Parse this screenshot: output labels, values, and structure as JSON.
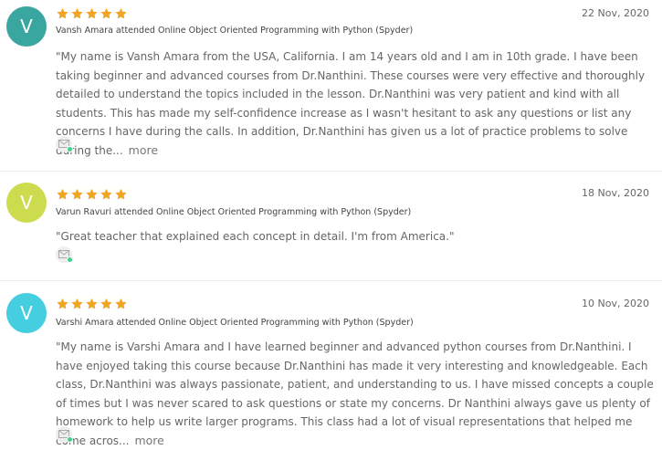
{
  "colors": {
    "star": "#f3a522",
    "verified_dot": "#3ecf8e"
  },
  "reviews": [
    {
      "avatar_letter": "V",
      "avatar_color": "#3aa6a0",
      "rating": 5,
      "date": "22 Nov, 2020",
      "attended": "Vansh Amara attended Online Object Oriented Programming with Python (Spyder)",
      "text": "\"My name is Vansh Amara from the USA, California. I am 14 years old and I am in 10th grade. I have been taking beginner and advanced courses from Dr.Nanthini. These courses were very effective and thoroughly detailed to understand the topics included in the lesson. Dr.Nanthini was very patient and kind with all students. This has made my self-confidence increase as I wasn't hesitant to ask any questions or list any concerns I have during the calls. In addition, Dr.Nanthini has given us a lot of practice problems to solve during the...",
      "more": "more",
      "icon": "mail-icon"
    },
    {
      "avatar_letter": "V",
      "avatar_color": "#cddc4f",
      "rating": 5,
      "date": "18 Nov, 2020",
      "attended": "Varun Ravuri attended Online Object Oriented Programming with Python (Spyder)",
      "text": "\"Great teacher that explained each concept in detail. I'm from America.\"",
      "icon": "mail-icon"
    },
    {
      "avatar_letter": "V",
      "avatar_color": "#45cde0",
      "rating": 5,
      "date": "10 Nov, 2020",
      "attended": "Varshi Amara attended Online Object Oriented Programming with Python (Spyder)",
      "text": "\"My name is Varshi Amara and I have learned beginner and advanced python courses from Dr.Nanthini. I have enjoyed taking this course because Dr.Nanthini has made it very interesting and knowledgeable. Each class, Dr.Nanthini was always passionate, patient, and understanding to us. I have missed concepts a couple of times but I was never scared to ask questions or state my concerns. Dr Nanthini always gave us plenty of homework to help us write larger programs. This class had a lot of visual representations that helped me come acros...",
      "more": "more",
      "icon": "mail-icon"
    }
  ]
}
